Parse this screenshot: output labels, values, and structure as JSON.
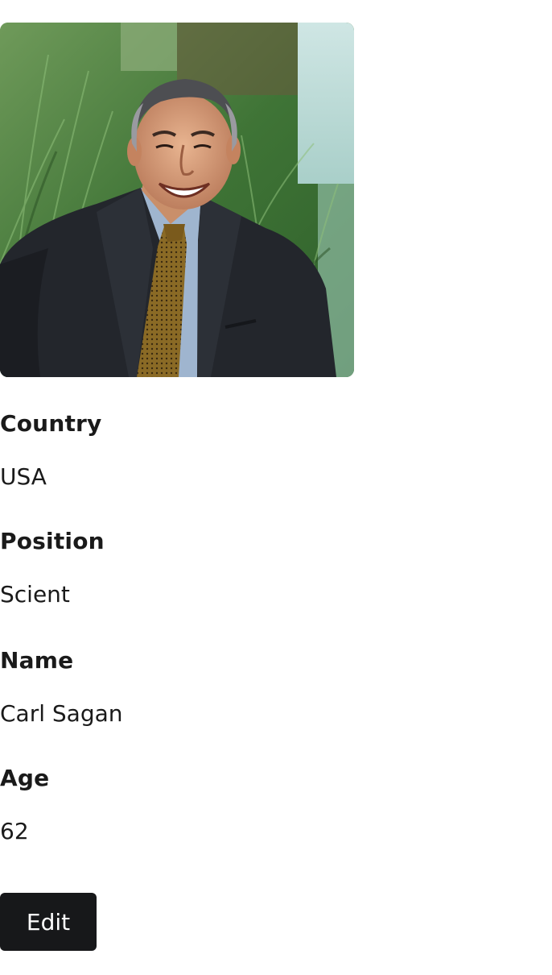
{
  "profile": {
    "photo_alt": "Carl Sagan",
    "fields": [
      {
        "label": "Country",
        "value": "USA"
      },
      {
        "label": "Position",
        "value": "Scient"
      },
      {
        "label": "Name",
        "value": "Carl Sagan"
      },
      {
        "label": "Age",
        "value": "62"
      }
    ],
    "edit_label": "Edit"
  },
  "colors": {
    "button_bg": "#17181a",
    "button_text": "#ffffff",
    "text": "#1a1a1a"
  }
}
